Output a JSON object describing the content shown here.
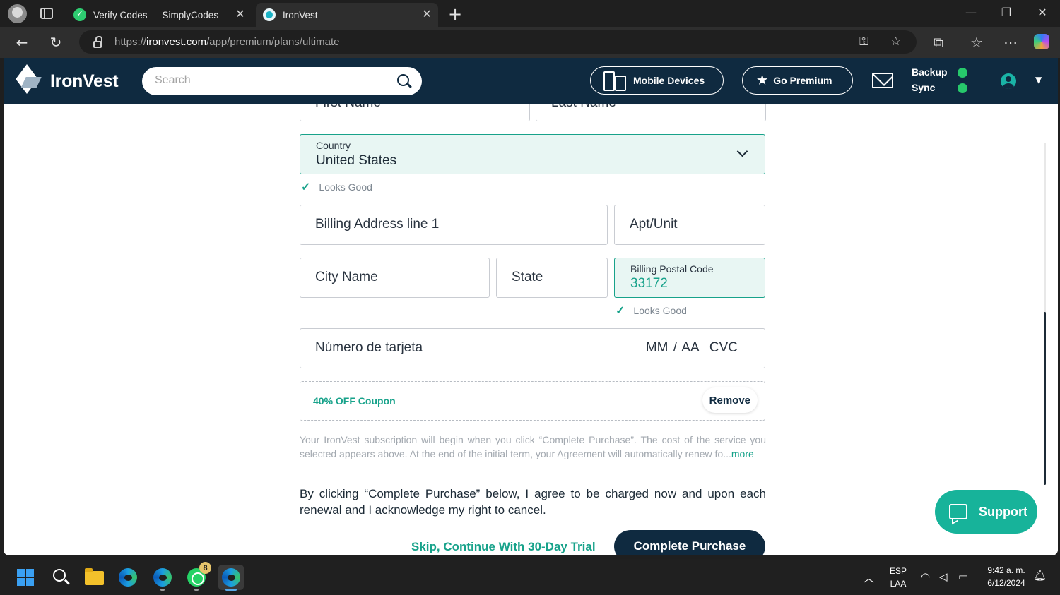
{
  "browser": {
    "tabs": [
      {
        "title": "Verify Codes — SimplyCodes",
        "favicon": "simplycodes-icon"
      },
      {
        "title": "IronVest",
        "favicon": "ironvest-icon"
      }
    ],
    "url_prefix": "https://",
    "url_domain": "ironvest.com",
    "url_path": "/app/premium/plans/ultimate"
  },
  "header": {
    "brand": "IronVest",
    "search_placeholder": "Search",
    "mobile_devices_label": "Mobile Devices",
    "go_premium_label": "Go Premium",
    "backup_label": "Backup",
    "sync_label": "Sync",
    "status_color": "#27c96b"
  },
  "form": {
    "first_name_placeholder": "First Name",
    "last_name_placeholder": "Last Name",
    "country_label": "Country",
    "country_value": "United States",
    "country_status": "Looks Good",
    "address_placeholder": "Billing Address line 1",
    "apt_placeholder": "Apt/Unit",
    "city_placeholder": "City Name",
    "state_placeholder": "State",
    "postal_label": "Billing Postal Code",
    "postal_value": "33172",
    "postal_status": "Looks Good",
    "card_number_placeholder": "Número de tarjeta",
    "card_expiry_placeholder": "MM / AA",
    "card_cvc_placeholder": "CVC",
    "coupon_label": "40% OFF Coupon",
    "remove_label": "Remove",
    "fine_print": "Your IronVest subscription will begin when you click “Complete Purchase”. The cost of the service you selected appears above. At the end of the initial term, your Agreement will automatically renew fo...",
    "more_label": "more",
    "agreement": "By clicking “Complete Purchase” below, I agree to be charged now and upon each renewal and I acknowledge my right to cancel.",
    "skip_label": "Skip, Continue With 30-Day Trial",
    "complete_label": "Complete Purchase"
  },
  "support_label": "Support",
  "colors": {
    "brand_navy": "#0f2a40",
    "accent_teal": "#17a28a",
    "support_teal": "#17b39a"
  },
  "taskbar": {
    "whatsapp_badge": "8",
    "lang_top": "ESP",
    "lang_bottom": "LAA",
    "time": "9:42 a. m.",
    "date": "6/12/2024"
  }
}
